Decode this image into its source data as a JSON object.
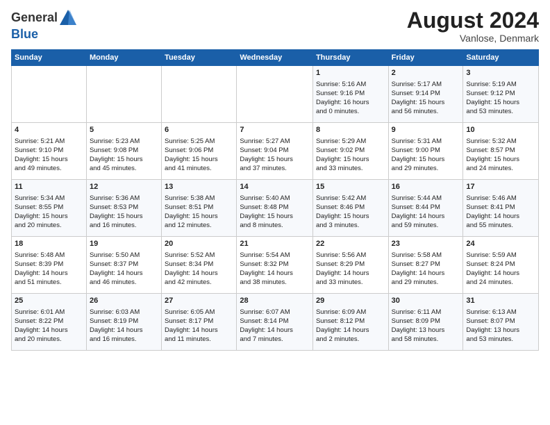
{
  "header": {
    "logo_line1": "General",
    "logo_line2": "Blue",
    "month_year": "August 2024",
    "location": "Vanlose, Denmark"
  },
  "weekdays": [
    "Sunday",
    "Monday",
    "Tuesday",
    "Wednesday",
    "Thursday",
    "Friday",
    "Saturday"
  ],
  "weeks": [
    [
      {
        "day": "",
        "text": ""
      },
      {
        "day": "",
        "text": ""
      },
      {
        "day": "",
        "text": ""
      },
      {
        "day": "",
        "text": ""
      },
      {
        "day": "1",
        "text": "Sunrise: 5:16 AM\nSunset: 9:16 PM\nDaylight: 16 hours\nand 0 minutes."
      },
      {
        "day": "2",
        "text": "Sunrise: 5:17 AM\nSunset: 9:14 PM\nDaylight: 15 hours\nand 56 minutes."
      },
      {
        "day": "3",
        "text": "Sunrise: 5:19 AM\nSunset: 9:12 PM\nDaylight: 15 hours\nand 53 minutes."
      }
    ],
    [
      {
        "day": "4",
        "text": "Sunrise: 5:21 AM\nSunset: 9:10 PM\nDaylight: 15 hours\nand 49 minutes."
      },
      {
        "day": "5",
        "text": "Sunrise: 5:23 AM\nSunset: 9:08 PM\nDaylight: 15 hours\nand 45 minutes."
      },
      {
        "day": "6",
        "text": "Sunrise: 5:25 AM\nSunset: 9:06 PM\nDaylight: 15 hours\nand 41 minutes."
      },
      {
        "day": "7",
        "text": "Sunrise: 5:27 AM\nSunset: 9:04 PM\nDaylight: 15 hours\nand 37 minutes."
      },
      {
        "day": "8",
        "text": "Sunrise: 5:29 AM\nSunset: 9:02 PM\nDaylight: 15 hours\nand 33 minutes."
      },
      {
        "day": "9",
        "text": "Sunrise: 5:31 AM\nSunset: 9:00 PM\nDaylight: 15 hours\nand 29 minutes."
      },
      {
        "day": "10",
        "text": "Sunrise: 5:32 AM\nSunset: 8:57 PM\nDaylight: 15 hours\nand 24 minutes."
      }
    ],
    [
      {
        "day": "11",
        "text": "Sunrise: 5:34 AM\nSunset: 8:55 PM\nDaylight: 15 hours\nand 20 minutes."
      },
      {
        "day": "12",
        "text": "Sunrise: 5:36 AM\nSunset: 8:53 PM\nDaylight: 15 hours\nand 16 minutes."
      },
      {
        "day": "13",
        "text": "Sunrise: 5:38 AM\nSunset: 8:51 PM\nDaylight: 15 hours\nand 12 minutes."
      },
      {
        "day": "14",
        "text": "Sunrise: 5:40 AM\nSunset: 8:48 PM\nDaylight: 15 hours\nand 8 minutes."
      },
      {
        "day": "15",
        "text": "Sunrise: 5:42 AM\nSunset: 8:46 PM\nDaylight: 15 hours\nand 3 minutes."
      },
      {
        "day": "16",
        "text": "Sunrise: 5:44 AM\nSunset: 8:44 PM\nDaylight: 14 hours\nand 59 minutes."
      },
      {
        "day": "17",
        "text": "Sunrise: 5:46 AM\nSunset: 8:41 PM\nDaylight: 14 hours\nand 55 minutes."
      }
    ],
    [
      {
        "day": "18",
        "text": "Sunrise: 5:48 AM\nSunset: 8:39 PM\nDaylight: 14 hours\nand 51 minutes."
      },
      {
        "day": "19",
        "text": "Sunrise: 5:50 AM\nSunset: 8:37 PM\nDaylight: 14 hours\nand 46 minutes."
      },
      {
        "day": "20",
        "text": "Sunrise: 5:52 AM\nSunset: 8:34 PM\nDaylight: 14 hours\nand 42 minutes."
      },
      {
        "day": "21",
        "text": "Sunrise: 5:54 AM\nSunset: 8:32 PM\nDaylight: 14 hours\nand 38 minutes."
      },
      {
        "day": "22",
        "text": "Sunrise: 5:56 AM\nSunset: 8:29 PM\nDaylight: 14 hours\nand 33 minutes."
      },
      {
        "day": "23",
        "text": "Sunrise: 5:58 AM\nSunset: 8:27 PM\nDaylight: 14 hours\nand 29 minutes."
      },
      {
        "day": "24",
        "text": "Sunrise: 5:59 AM\nSunset: 8:24 PM\nDaylight: 14 hours\nand 24 minutes."
      }
    ],
    [
      {
        "day": "25",
        "text": "Sunrise: 6:01 AM\nSunset: 8:22 PM\nDaylight: 14 hours\nand 20 minutes."
      },
      {
        "day": "26",
        "text": "Sunrise: 6:03 AM\nSunset: 8:19 PM\nDaylight: 14 hours\nand 16 minutes."
      },
      {
        "day": "27",
        "text": "Sunrise: 6:05 AM\nSunset: 8:17 PM\nDaylight: 14 hours\nand 11 minutes."
      },
      {
        "day": "28",
        "text": "Sunrise: 6:07 AM\nSunset: 8:14 PM\nDaylight: 14 hours\nand 7 minutes."
      },
      {
        "day": "29",
        "text": "Sunrise: 6:09 AM\nSunset: 8:12 PM\nDaylight: 14 hours\nand 2 minutes."
      },
      {
        "day": "30",
        "text": "Sunrise: 6:11 AM\nSunset: 8:09 PM\nDaylight: 13 hours\nand 58 minutes."
      },
      {
        "day": "31",
        "text": "Sunrise: 6:13 AM\nSunset: 8:07 PM\nDaylight: 13 hours\nand 53 minutes."
      }
    ]
  ]
}
